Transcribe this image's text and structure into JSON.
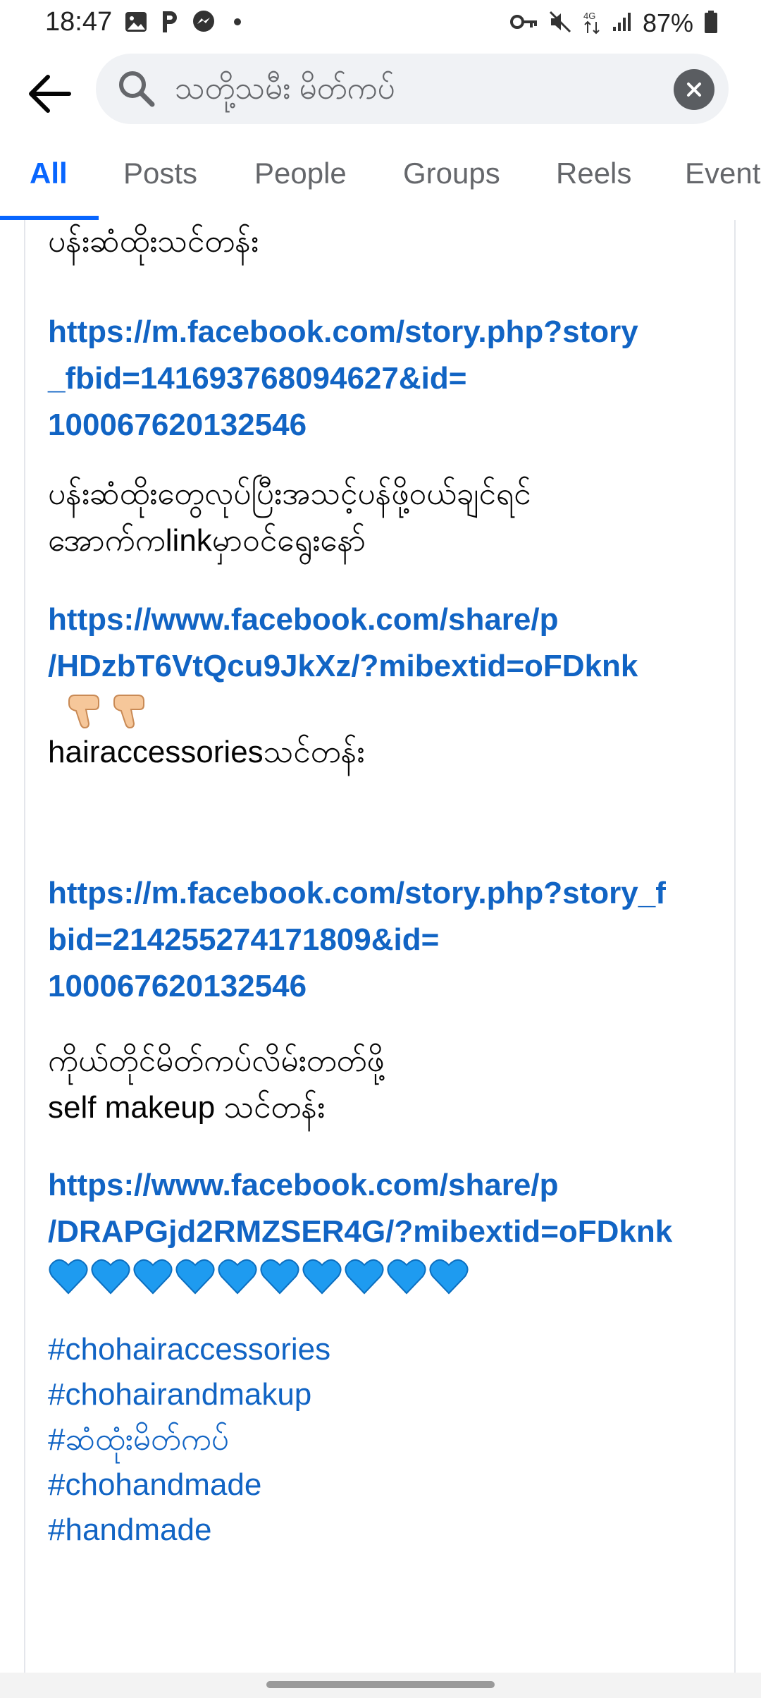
{
  "status_bar": {
    "time": "18:47",
    "battery": "87%",
    "icons_left": [
      "image-icon",
      "p-icon",
      "messenger-icon",
      "dot-icon"
    ],
    "icons_right": [
      "key-icon",
      "mute-icon",
      "4g-icon",
      "signal-icon",
      "battery-icon"
    ]
  },
  "search": {
    "query": "သတို့သမီး မိတ်ကပ်"
  },
  "tabs": [
    {
      "label": "All",
      "active": true
    },
    {
      "label": "Posts"
    },
    {
      "label": "People"
    },
    {
      "label": "Groups"
    },
    {
      "label": "Reels"
    },
    {
      "label": "Event"
    }
  ],
  "post": {
    "line1": "ပန်းဆံထိုးသင်တန်း",
    "link1": [
      "https://m.facebook.com/story.php?story",
      "_fbid=141693768094627&id=",
      "100067620132546"
    ],
    "text2": [
      "ပန်းဆံထိုးတွေလုပ်ပြီးအသင့်ပန်ဖို့ဝယ်ချင်ရင်",
      "အောက်ကlinkမှာဝင်ရွေးနော်"
    ],
    "link2": [
      "https://www.facebook.com/share/p",
      "/HDzbT6VtQcu9JkXz/?mibextid=oFDknk"
    ],
    "text3": "hairaccessoriesသင်တန်း",
    "link3": [
      "https://m.facebook.com/story.php?story_f",
      "bid=214255274171809&id=",
      "100067620132546"
    ],
    "text4": [
      "ကိုယ်တိုင်မိတ်ကပ်လိမ်းတတ်ဖို့",
      "self makeup သင်တန်း"
    ],
    "link4": [
      "https://www.facebook.com/share/p",
      "/DRAPGjd2RMZSER4G/?mibextid=oFDknk"
    ],
    "hashtags": [
      "#chohairaccessories",
      "#chohairandmakup",
      "#ဆံထုံးမိတ်ကပ်",
      "#chohandmade",
      "#handmade"
    ]
  }
}
